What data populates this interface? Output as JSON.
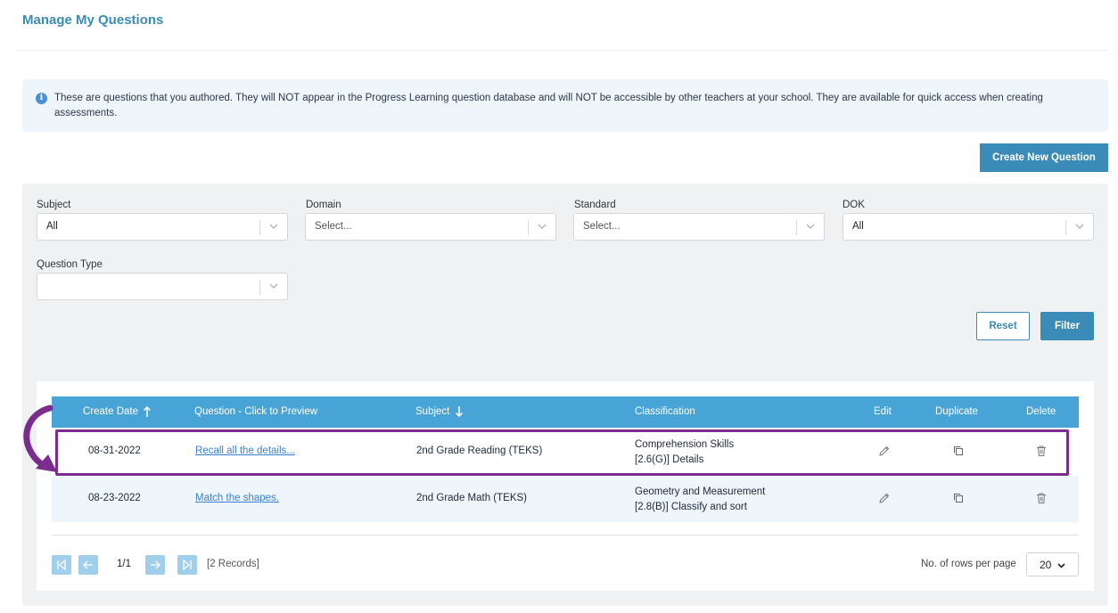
{
  "page": {
    "title": "Manage My Questions"
  },
  "info": {
    "text": "These are questions that you authored. They will NOT appear in the Progress Learning question database and will NOT be accessible by other teachers at your school. They are available for quick access when creating assessments."
  },
  "actions": {
    "create_label": "Create New Question",
    "reset_label": "Reset",
    "filter_label": "Filter"
  },
  "filters": {
    "subject": {
      "label": "Subject",
      "value": "All"
    },
    "domain": {
      "label": "Domain",
      "placeholder": "Select..."
    },
    "standard": {
      "label": "Standard",
      "placeholder": "Select..."
    },
    "dok": {
      "label": "DOK",
      "value": "All"
    },
    "question_type": {
      "label": "Question Type",
      "value": ""
    }
  },
  "table": {
    "headers": {
      "create_date": "Create Date",
      "question": "Question - Click to Preview",
      "subject": "Subject",
      "classification": "Classification",
      "edit": "Edit",
      "duplicate": "Duplicate",
      "delete": "Delete"
    },
    "rows": [
      {
        "date": "08-31-2022",
        "question": "Recall all the details...",
        "subject": "2nd Grade Reading (TEKS)",
        "classification_line1": "Comprehension Skills",
        "classification_line2": "[2.6(G)] Details"
      },
      {
        "date": "08-23-2022",
        "question": "Match the shapes.",
        "subject": "2nd Grade Math (TEKS)",
        "classification_line1": "Geometry and Measurement",
        "classification_line2": "[2.8(B)] Classify and sort"
      }
    ]
  },
  "pagination": {
    "page": "1/1",
    "records": "[2 Records]",
    "rows_label": "No. of rows per page",
    "rows_value": "20"
  },
  "colors": {
    "accent": "#3a8bb7",
    "header_bg": "#48a3d7",
    "highlight": "#7b2d8e"
  }
}
